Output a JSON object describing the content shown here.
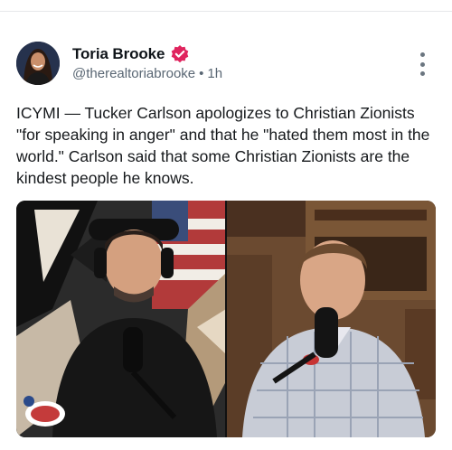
{
  "post": {
    "author_name": "Toria Brooke",
    "handle": "@therealtoriabrooke",
    "separator": "•",
    "time": "1h",
    "text": "ICYMI — Tucker Carlson apologizes to Christian Zionists \"for speaking in anger\" and that he \"hated them most in the world.\" Carlson said that some Christian Zionists are the kindest people he knows."
  },
  "icons": {
    "verified": "verified-badge-icon",
    "more": "more-vertical-icon"
  },
  "colors": {
    "verified_badge": "#e0245e",
    "handle": "#596673",
    "text": "#16191c"
  }
}
